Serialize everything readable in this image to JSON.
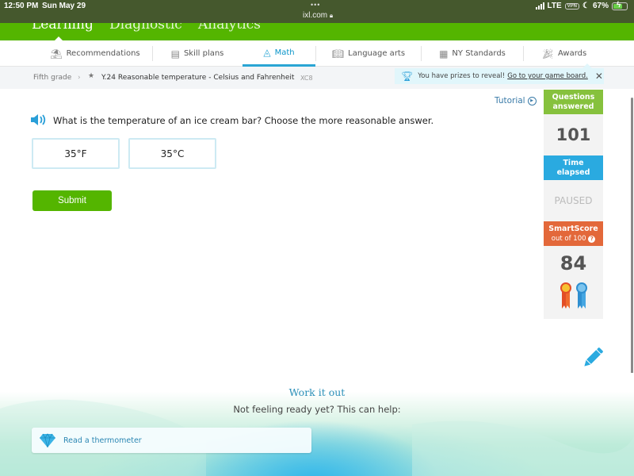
{
  "status_bar": {
    "time": "12:50 PM",
    "date": "Sun May 29",
    "url": "ixl.com",
    "network": "LTE",
    "vpn": "VPN",
    "battery": "67%",
    "battery_level": 0.67
  },
  "top_nav": {
    "items": [
      {
        "label": "Learning",
        "active": true
      },
      {
        "label": "Diagnostic",
        "active": false
      },
      {
        "label": "Analytics",
        "active": false
      }
    ]
  },
  "sub_nav": {
    "tabs": [
      {
        "label": "Recommendations",
        "icon": "recommendations-icon",
        "active": false
      },
      {
        "label": "Skill plans",
        "icon": "skill-plans-icon",
        "active": false
      },
      {
        "label": "Math",
        "icon": "pyramid-icon",
        "active": true
      },
      {
        "label": "Language arts",
        "icon": "book-icon",
        "active": false
      },
      {
        "label": "NY Standards",
        "icon": "standards-icon",
        "active": false
      },
      {
        "label": "Awards",
        "icon": "confetti-icon",
        "active": false
      }
    ]
  },
  "breadcrumb": {
    "grade": "Fifth grade",
    "skill": "Y.24 Reasonable temperature - Celsius and Fahrenheit",
    "code": "XC8"
  },
  "prize_banner": {
    "text": "You have prizes to reveal!",
    "link": "Go to your game board."
  },
  "tutorial_label": "Tutorial",
  "question": {
    "text": "What is the temperature of an ice cream bar? Choose the more reasonable answer.",
    "choices": [
      "35°F",
      "35°C"
    ],
    "submit_label": "Submit"
  },
  "stats": {
    "questions_answered_label_1": "Questions",
    "questions_answered_label_2": "answered",
    "questions_answered": "101",
    "time_elapsed_label_1": "Time",
    "time_elapsed_label_2": "elapsed",
    "time_elapsed": "PAUSED",
    "smartscore_label": "SmartScore",
    "smartscore_sub": "out of 100",
    "smartscore_help": "?",
    "smartscore": "84"
  },
  "work_it_out": {
    "title": "Work it out",
    "subtitle": "Not feeling ready yet? This can help:",
    "helpers": [
      {
        "label": "Read a thermometer",
        "icon": "diamond-icon"
      }
    ]
  },
  "colors": {
    "brand_green": "#54b500",
    "accent_blue": "#2aaae0",
    "smartscore_orange": "#e3683a",
    "questions_green": "#86c13d"
  }
}
